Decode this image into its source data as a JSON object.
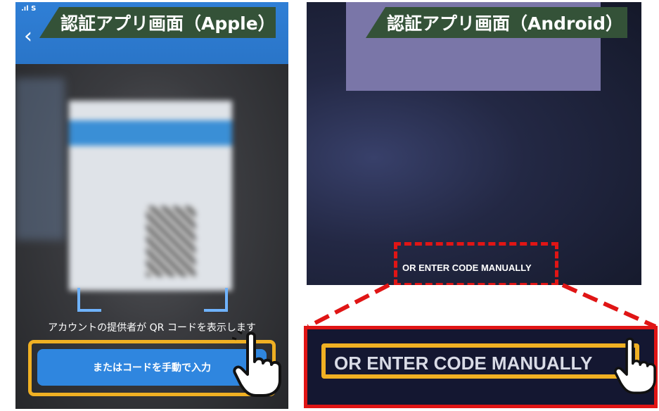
{
  "labels": {
    "apple": "認証アプリ画面（Apple）",
    "android": "認証アプリ画面（Android）"
  },
  "apple": {
    "status_text": ".ıl S",
    "hint_text": "アカウントの提供者が QR コードを表示します",
    "manual_button": "またはコードを手動で入力"
  },
  "android": {
    "manual_link": "OR ENTER CODE MANUALLY"
  },
  "zoom": {
    "manual_link": "OR ENTER CODE MANUALLY"
  },
  "icons": {
    "back": "chevron-left-icon",
    "pointer": "hand-pointer-icon"
  },
  "colors": {
    "label_bg": "#345238",
    "highlight_yellow": "#f0b023",
    "highlight_red": "#e01515",
    "apple_blue": "#2f86df"
  }
}
